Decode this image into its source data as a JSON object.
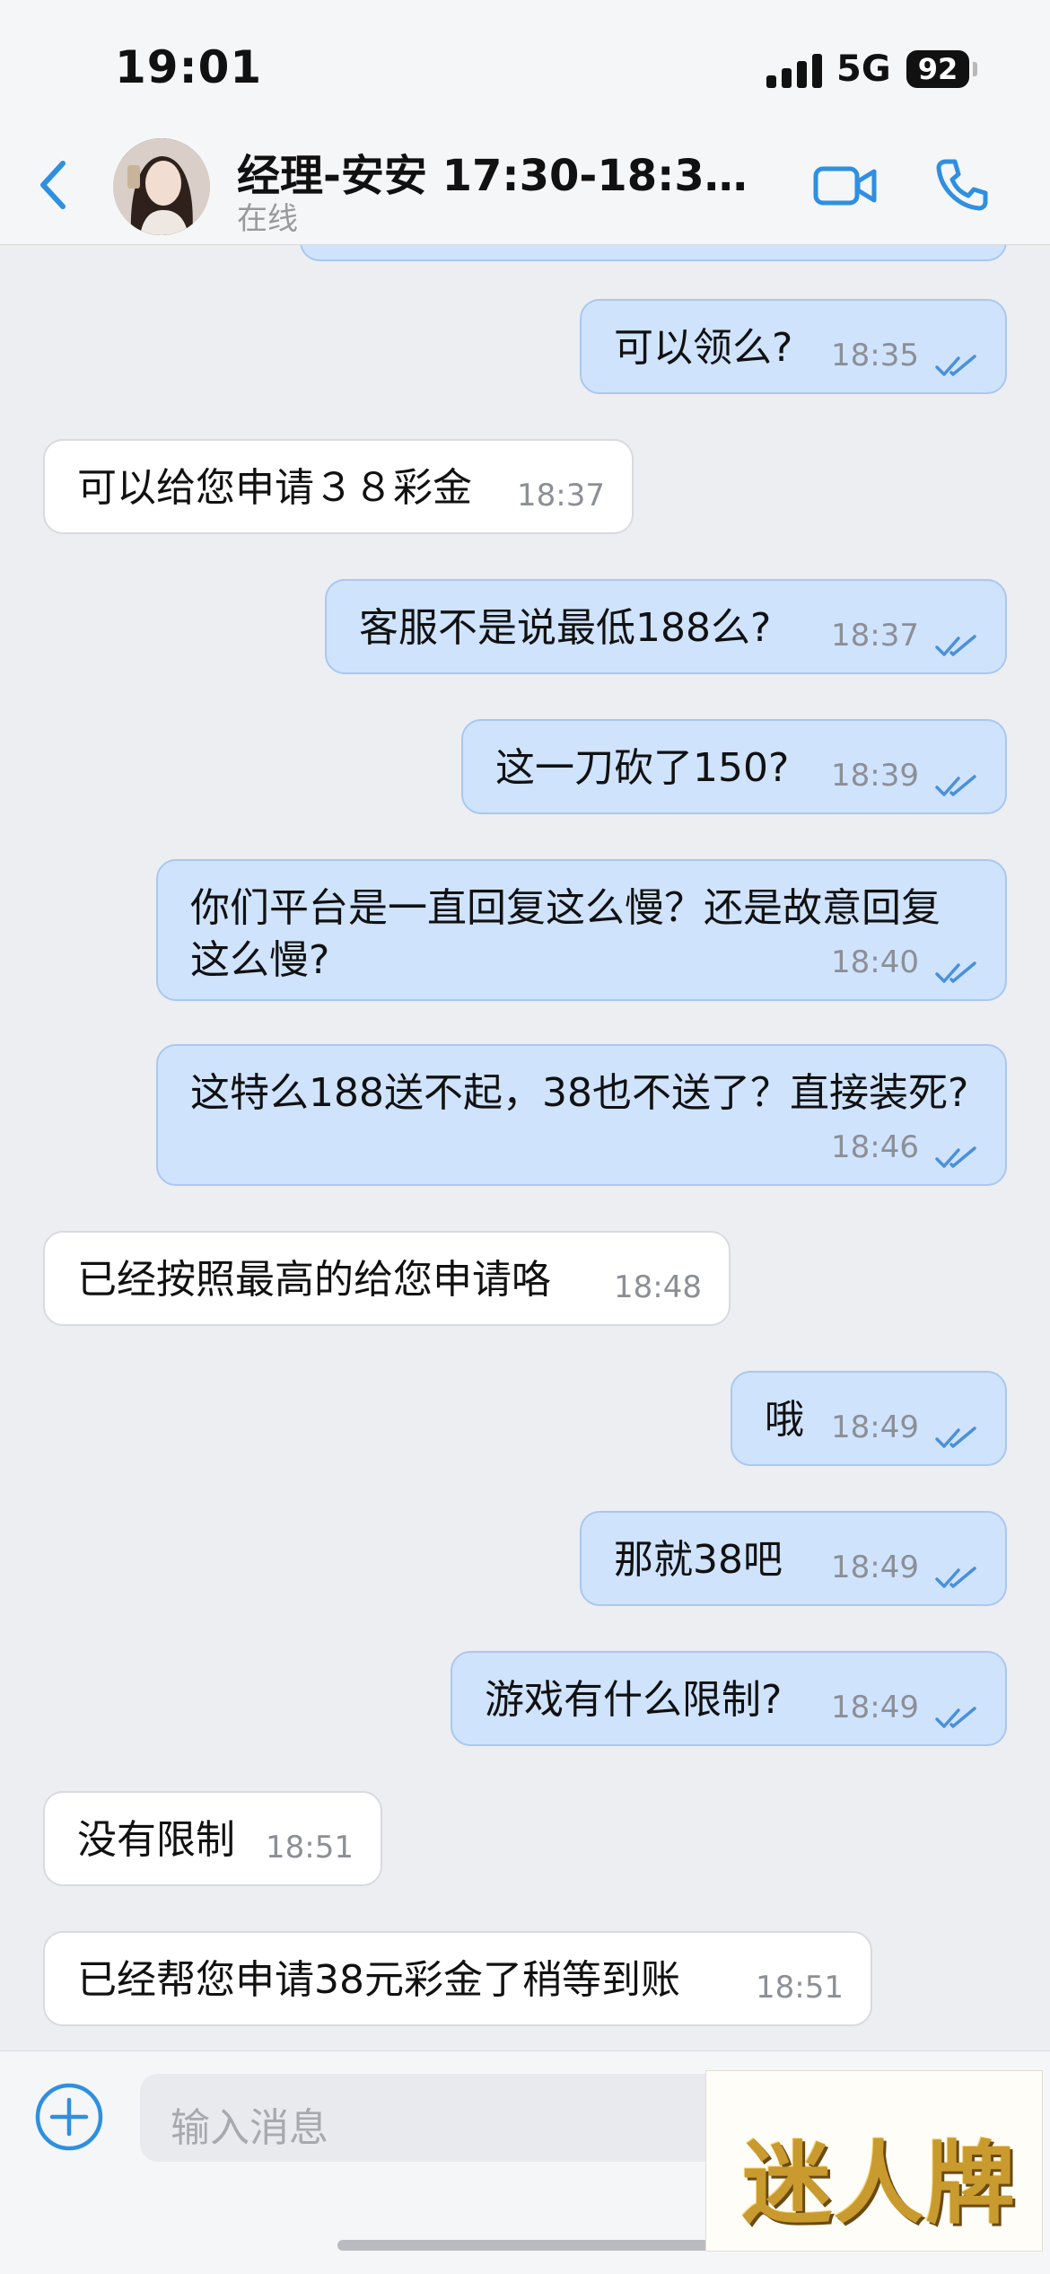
{
  "status_bar": {
    "time": "19:01",
    "network": "5G",
    "battery": "92"
  },
  "header": {
    "contact_name": "经理-安安 17:30-18:30 ...",
    "contact_status": "在线"
  },
  "messages": [
    {
      "direction": "out",
      "text": "可以领么?",
      "time": "18:35",
      "read": true
    },
    {
      "direction": "in",
      "text": "可以给您申请３８彩金",
      "time": "18:37"
    },
    {
      "direction": "out",
      "text": "客服不是说最低188么?",
      "time": "18:37",
      "read": true
    },
    {
      "direction": "out",
      "text": "这一刀砍了150?",
      "time": "18:39",
      "read": true
    },
    {
      "direction": "out",
      "text": "你们平台是一直回复这么慢？还是故意回复这么慢?",
      "time": "18:40",
      "read": true
    },
    {
      "direction": "out",
      "text": "这特么188送不起，38也不送了？直接装死?",
      "time": "18:46",
      "read": true
    },
    {
      "direction": "in",
      "text": "已经按照最高的给您申请咯",
      "time": "18:48"
    },
    {
      "direction": "out",
      "text": "哦",
      "time": "18:49",
      "read": true
    },
    {
      "direction": "out",
      "text": "那就38吧",
      "time": "18:49",
      "read": true
    },
    {
      "direction": "out",
      "text": "游戏有什么限制?",
      "time": "18:49",
      "read": true
    },
    {
      "direction": "in",
      "text": "没有限制",
      "time": "18:51"
    },
    {
      "direction": "in",
      "text": "已经帮您申请38元彩金了稍等到账",
      "time": "18:51"
    }
  ],
  "composer": {
    "placeholder": "输入消息"
  },
  "watermark": {
    "text": "迷人牌"
  },
  "colors": {
    "accent": "#2f8fe0",
    "outgoing_bubble": "#cfe3fd",
    "incoming_bubble": "#ffffff",
    "read_ticks": "#4a90d9"
  },
  "icons": [
    "back-chevron-icon",
    "video-call-icon",
    "phone-icon",
    "read-ticks-icon",
    "plus-circle-icon"
  ]
}
